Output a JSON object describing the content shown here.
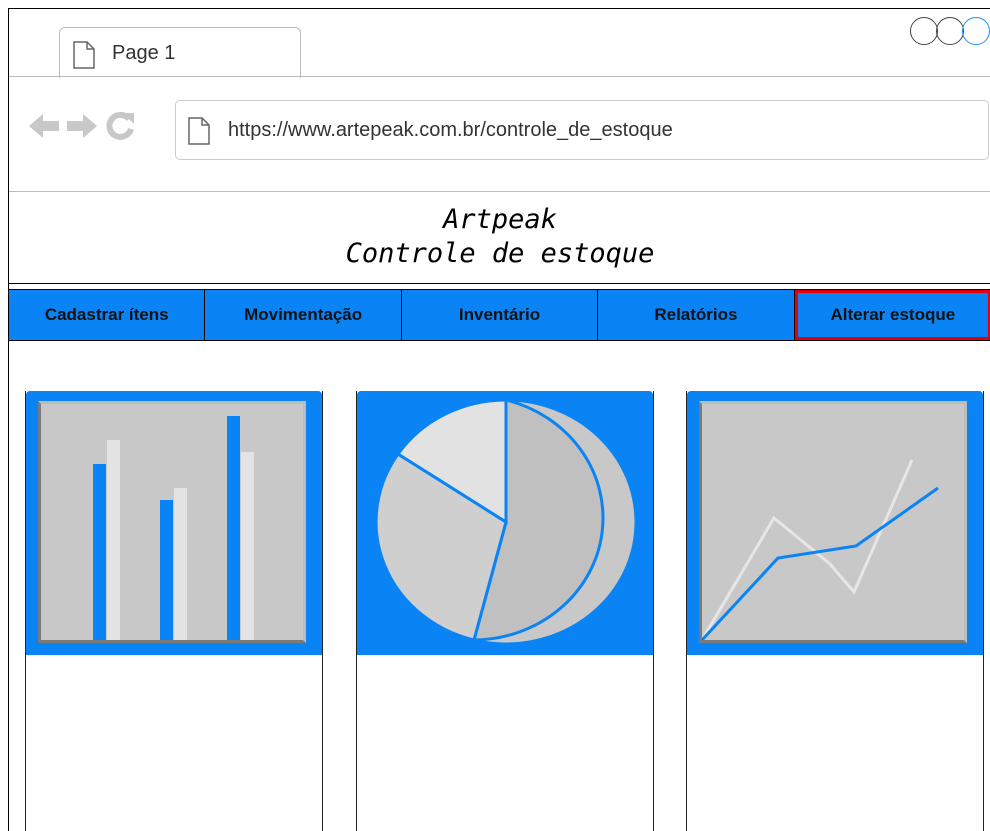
{
  "browser": {
    "tab_label": "Page 1",
    "url": "https://www.artepeak.com.br/controle_de_estoque",
    "icons": [
      "page-icon",
      "back-arrow-icon",
      "forward-arrow-icon",
      "reload-icon"
    ]
  },
  "header": {
    "title": "Artpeak",
    "subtitle": "Controle de estoque"
  },
  "menu": {
    "items": [
      {
        "label": "Cadastrar ítens"
      },
      {
        "label": "Movimentação"
      },
      {
        "label": "Inventário"
      },
      {
        "label": "Relatórios"
      },
      {
        "label": "Alterar estoque",
        "active": true
      }
    ]
  },
  "colors": {
    "accent": "#0a84f5",
    "highlight": "#e00010",
    "chart_bg": "#c8c8c8"
  },
  "cards": [
    {
      "icon": "bar-chart-icon"
    },
    {
      "icon": "pie-chart-icon"
    },
    {
      "icon": "line-chart-icon"
    }
  ]
}
